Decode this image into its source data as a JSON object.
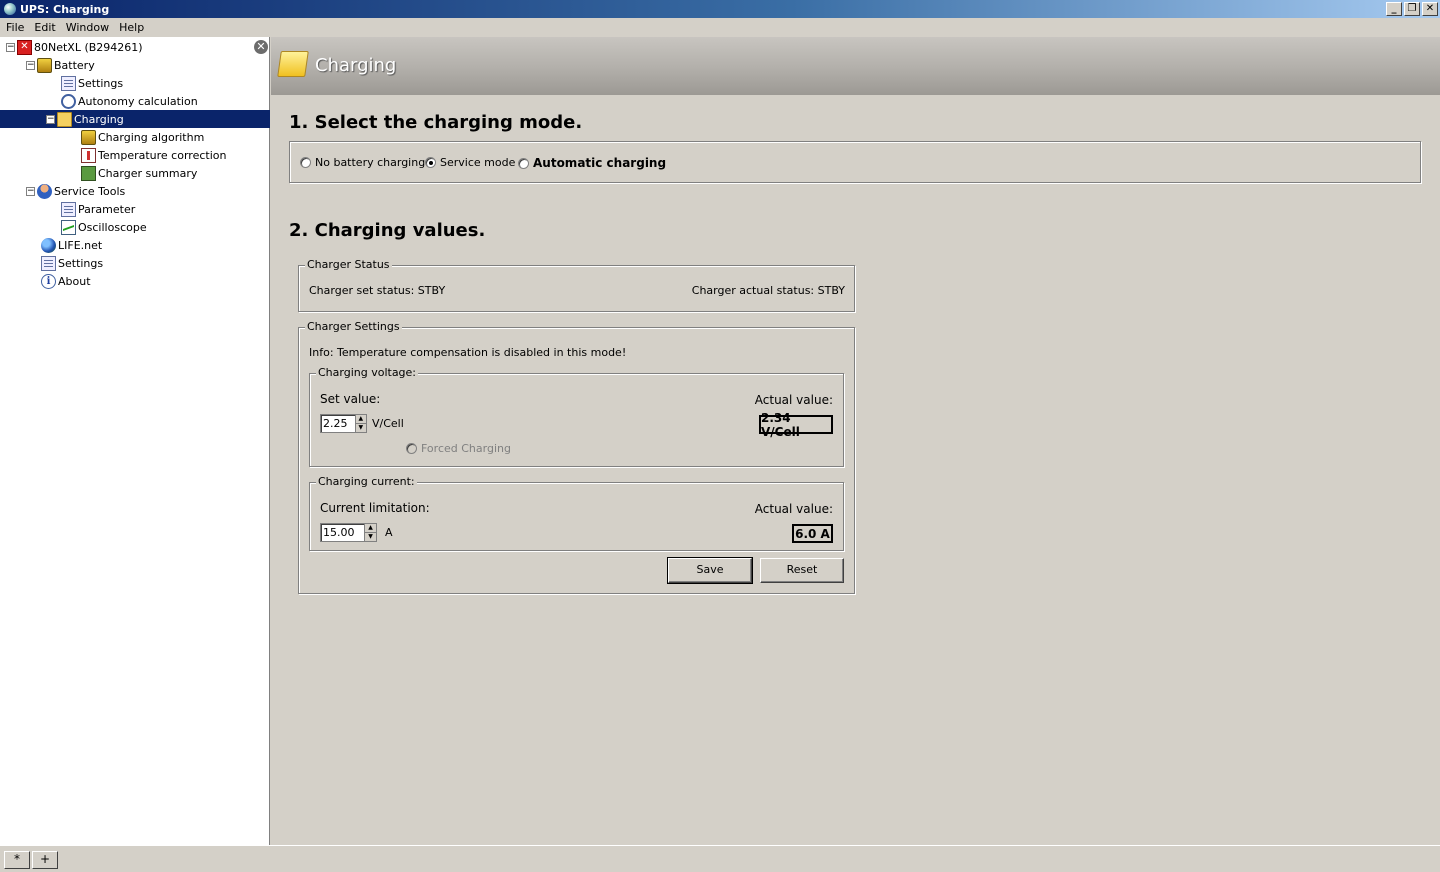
{
  "window": {
    "title": "UPS: Charging",
    "minimize": "_",
    "restore": "❐",
    "close": "✕"
  },
  "menu": [
    "File",
    "Edit",
    "Window",
    "Help"
  ],
  "tree": {
    "close_glyph": "✕",
    "items": [
      {
        "label": "80NetXL (B294261)",
        "icon": "error-icon"
      },
      {
        "label": "Battery",
        "icon": "battery-icon"
      },
      {
        "label": "Settings",
        "icon": "settings-doc-icon"
      },
      {
        "label": "Autonomy calculation",
        "icon": "clock-icon"
      },
      {
        "label": "Charging",
        "icon": "folder-icon",
        "selected": true
      },
      {
        "label": "Charging algorithm",
        "icon": "battery-icon"
      },
      {
        "label": "Temperature correction",
        "icon": "thermometer-icon"
      },
      {
        "label": "Charger summary",
        "icon": "summary-icon"
      },
      {
        "label": "Service Tools",
        "icon": "person-icon"
      },
      {
        "label": "Parameter",
        "icon": "document-icon"
      },
      {
        "label": "Oscilloscope",
        "icon": "oscilloscope-icon"
      },
      {
        "label": "LIFE.net",
        "icon": "globe-icon"
      },
      {
        "label": "Settings",
        "icon": "settings-doc-icon"
      },
      {
        "label": "About",
        "icon": "info-icon"
      }
    ]
  },
  "header": {
    "title": "Charging"
  },
  "section1": {
    "title": "1. Select the charging mode.",
    "options": [
      {
        "label": "No battery charging",
        "checked": false
      },
      {
        "label": "Service mode",
        "checked": true
      },
      {
        "label": "Automatic charging",
        "checked": false
      }
    ]
  },
  "section2": {
    "title": "2. Charging values.",
    "status": {
      "legend": "Charger Status",
      "set_status": "Charger set status: STBY",
      "actual_status": "Charger actual status: STBY"
    },
    "settings": {
      "legend": "Charger Settings",
      "info": "Info: Temperature compensation is disabled in this mode!",
      "voltage": {
        "legend": "Charging voltage:",
        "set_label": "Set value:",
        "set_value": "2.25",
        "unit": "V/Cell",
        "forced": "Forced Charging",
        "actual_label": "Actual value:",
        "actual_value": "2.34 V/Cell"
      },
      "current": {
        "legend": "Charging current:",
        "limit_label": "Current limitation:",
        "limit_value": "15.00",
        "unit": "A",
        "actual_label": "Actual value:",
        "actual_value": "6.0 A"
      },
      "save": "Save",
      "reset": "Reset"
    }
  },
  "bottom": {
    "star": "*",
    "plus": "+"
  }
}
